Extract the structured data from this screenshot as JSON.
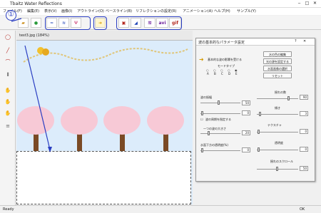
{
  "app": {
    "title": "Tbaitz Water Reflections"
  },
  "menu": {
    "items": [
      "ファイル(F)",
      "編集(E)",
      "表示(V)",
      "画像(I)",
      "アウトライン(O)",
      "ベースライン(B)",
      "リフレクションの設定(R)",
      "アニメーション(A)",
      "ヘルプ(H)",
      "サンプル(Y)"
    ]
  },
  "toolbar": {
    "icons": [
      "open-folder",
      "paint-colors",
      "waves-1",
      "waves-2",
      "ripple",
      "arrow-right",
      "preview-image",
      "triangle-blue"
    ],
    "avi_label": "avi",
    "gif_label": "gif"
  },
  "callouts": {
    "c1": "①",
    "c2": "②",
    "c3": "③",
    "c4": "④",
    "c5": "⑤",
    "c6": "⑥"
  },
  "document": {
    "tab_label": "test3.jpg (184%)"
  },
  "panel": {
    "title": "波の基本的なパラメータ設定",
    "buttons": [
      "水の色の編集",
      "光の源を設定する",
      "水面画像の選択",
      "リセット"
    ],
    "toggle_label": "基本的な波の影響を受ける",
    "mode_label": "モードタイプ",
    "radio_options": [
      "A",
      "B",
      "C",
      "D",
      "E"
    ],
    "left_params": [
      {
        "label": "波の振幅",
        "value": "50"
      },
      {
        "label": "",
        "value": "0"
      },
      {
        "label": "一つの波の大きさ",
        "value": "20"
      },
      {
        "label": "水面下方の透明度(%)",
        "value": "0"
      }
    ],
    "checkbox_label": "波の周期を指定する",
    "right_params": [
      {
        "label": "揺れの数",
        "value": "90"
      },
      {
        "label": "傾き",
        "value": "3"
      },
      {
        "label": "テクスチャ",
        "value": "0"
      },
      {
        "label": "透明度",
        "value": "0"
      },
      {
        "label": "揺れのスクロール",
        "value": "50"
      }
    ]
  },
  "status": {
    "left": "Ready",
    "right": "OK"
  }
}
